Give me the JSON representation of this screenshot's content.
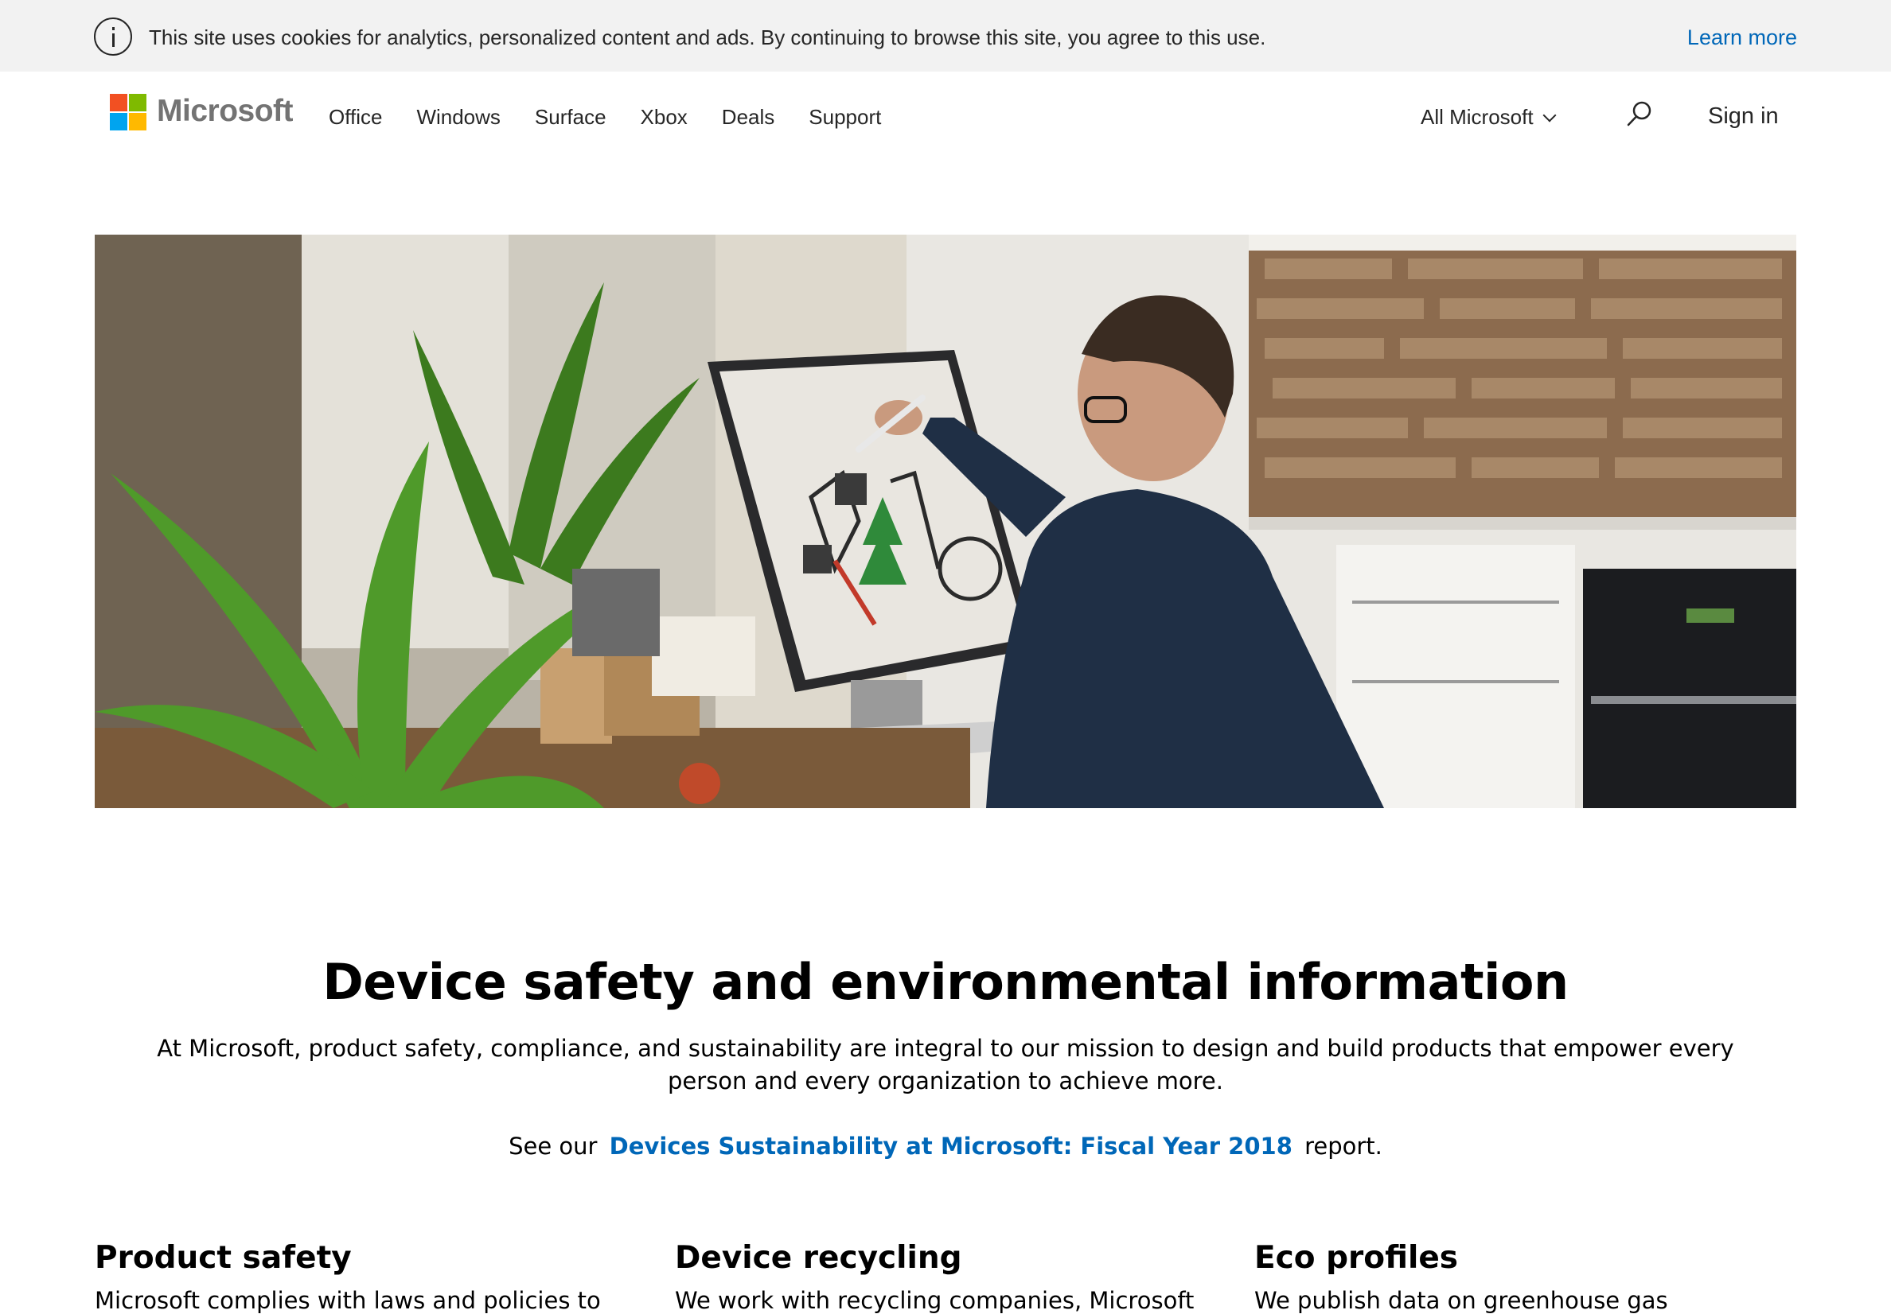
{
  "cookie_banner": {
    "icon": "info-icon",
    "text": "This site uses cookies for analytics, personalized content and ads. By continuing to browse this site, you agree to this use.",
    "learn_more": "Learn more"
  },
  "header": {
    "logo_text": "Microsoft",
    "nav": [
      "Office",
      "Windows",
      "Surface",
      "Xbox",
      "Deals",
      "Support"
    ],
    "all_microsoft": "All Microsoft",
    "search_icon": "search-icon",
    "sign_in": "Sign in"
  },
  "hero": {
    "image": "man-drawing-on-surface-studio-photo"
  },
  "main": {
    "title": "Device safety and environmental information",
    "intro": "At Microsoft, product safety, compliance, and sustainability are integral to our mission to design and build products that empower every person and every organization to achieve more.",
    "see_prefix": "See our",
    "report_link": "Devices Sustainability at Microsoft: Fiscal Year 2018",
    "see_suffix": "report."
  },
  "sections": [
    {
      "title": "Product safety",
      "text": "Microsoft complies with laws and policies to"
    },
    {
      "title": "Device recycling",
      "text": "We work with recycling companies, Microsoft"
    },
    {
      "title": "Eco profiles",
      "text": "We publish data on greenhouse gas emissions,"
    }
  ],
  "colors": {
    "link": "#0067b8",
    "banner_bg": "#f2f2f2",
    "logo_red": "#f25022",
    "logo_green": "#7fba00",
    "logo_blue": "#00a4ef",
    "logo_yellow": "#ffb900"
  }
}
